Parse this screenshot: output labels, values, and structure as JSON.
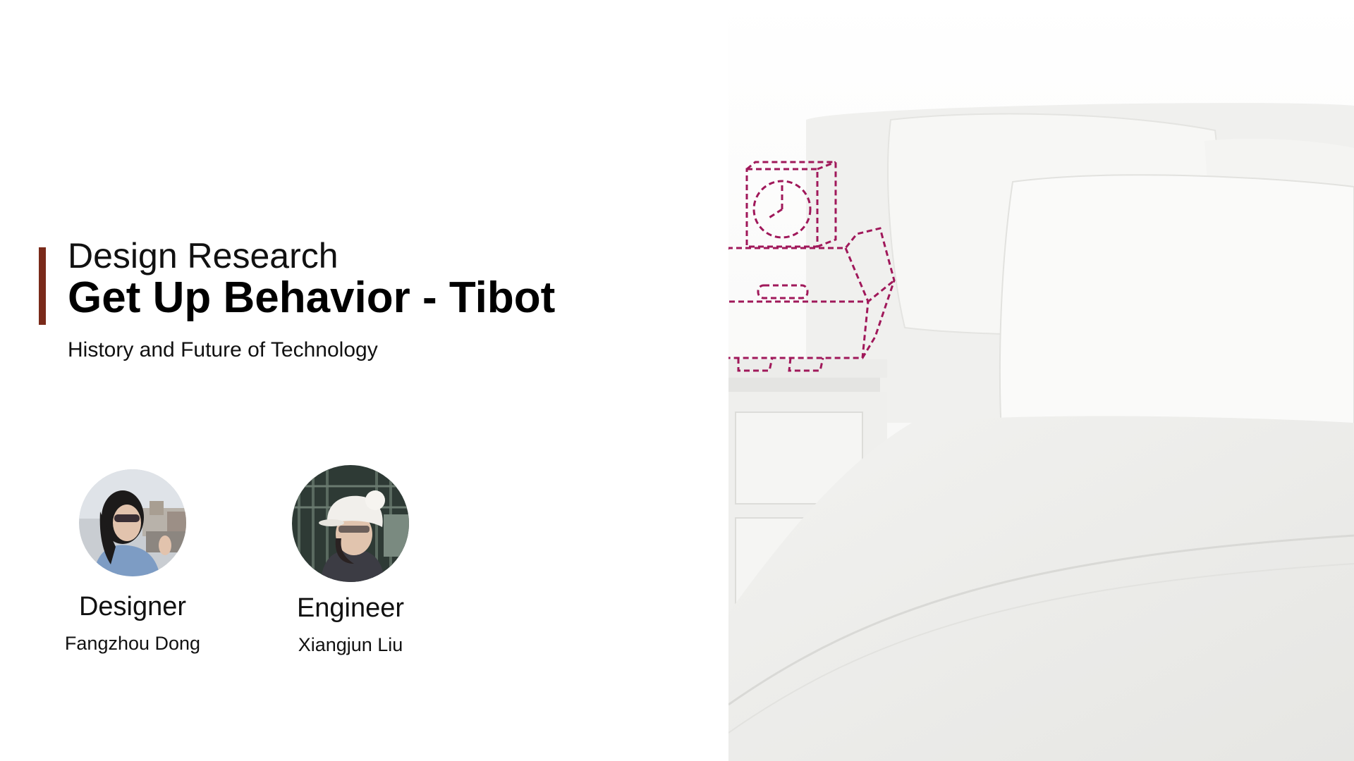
{
  "heading": {
    "kicker": "Design Research",
    "title": "Get Up Behavior - Tibot",
    "subtitle": "History and Future of Technology"
  },
  "team": [
    {
      "role": "Designer",
      "name": "Fangzhou Dong"
    },
    {
      "role": "Engineer",
      "name": "Xiangjun Liu"
    }
  ],
  "colors": {
    "accent": "#7a2a1a",
    "sketch": "#a0185a"
  },
  "icons": {
    "robot_sketch": "alarm-clock-robot-sketch-icon",
    "clock": "clock-icon"
  }
}
